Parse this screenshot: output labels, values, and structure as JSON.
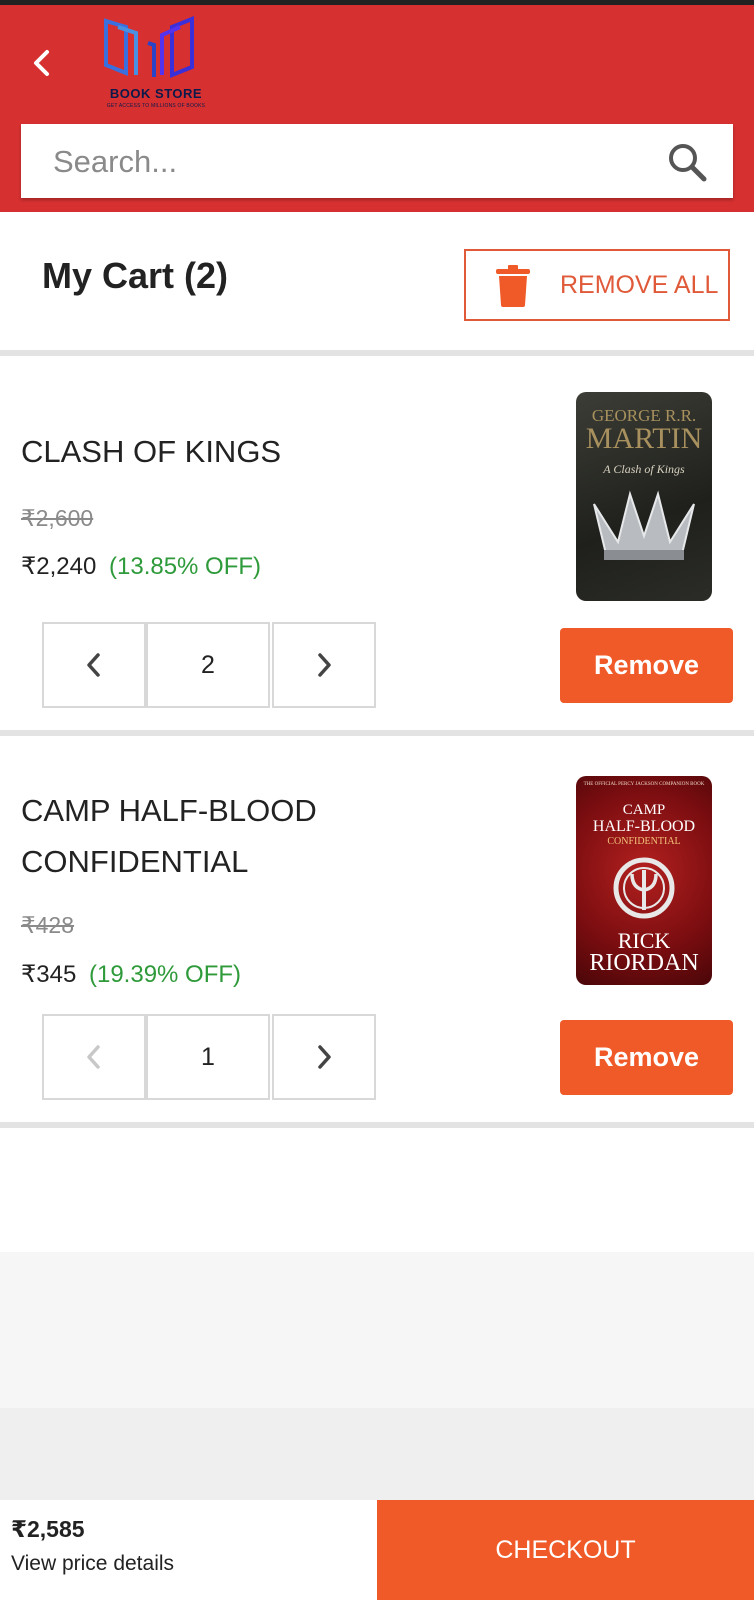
{
  "header": {
    "logo_title": "BOOK STORE",
    "logo_subtitle": "GET ACCESS TO MILLIONS OF BOOKS",
    "search_placeholder": "Search..."
  },
  "cart": {
    "title": "My Cart (2)",
    "remove_all_label": "REMOVE ALL",
    "items": [
      {
        "title": "CLASH OF KINGS",
        "old_price": "₹2,600",
        "price": "₹2,240",
        "discount": "(13.85% OFF)",
        "quantity": "2",
        "remove_label": "Remove",
        "cover": {
          "author_top": "GEORGE R.R.",
          "author_main": "MARTIN",
          "book": "A Clash of Kings"
        }
      },
      {
        "title": "CAMP HALF-BLOOD CONFIDENTIAL",
        "old_price": "₹428",
        "price": "₹345",
        "discount": "(19.39% OFF)",
        "quantity": "1",
        "remove_label": "Remove",
        "cover": {
          "series": "THE OFFICIAL PERCY JACKSON COMPANION BOOK",
          "title_1": "CAMP",
          "title_2": "HALF-BLOOD",
          "title_3": "CONFIDENTIAL",
          "author_1": "RICK",
          "author_2": "RIORDAN"
        }
      }
    ]
  },
  "footer": {
    "total": "₹2,585",
    "view_details_label": "View price details",
    "checkout_label": "CHECKOUT"
  },
  "colors": {
    "header_red": "#d63031",
    "accent_orange": "#f05a28",
    "discount_green": "#2e9a3a"
  }
}
